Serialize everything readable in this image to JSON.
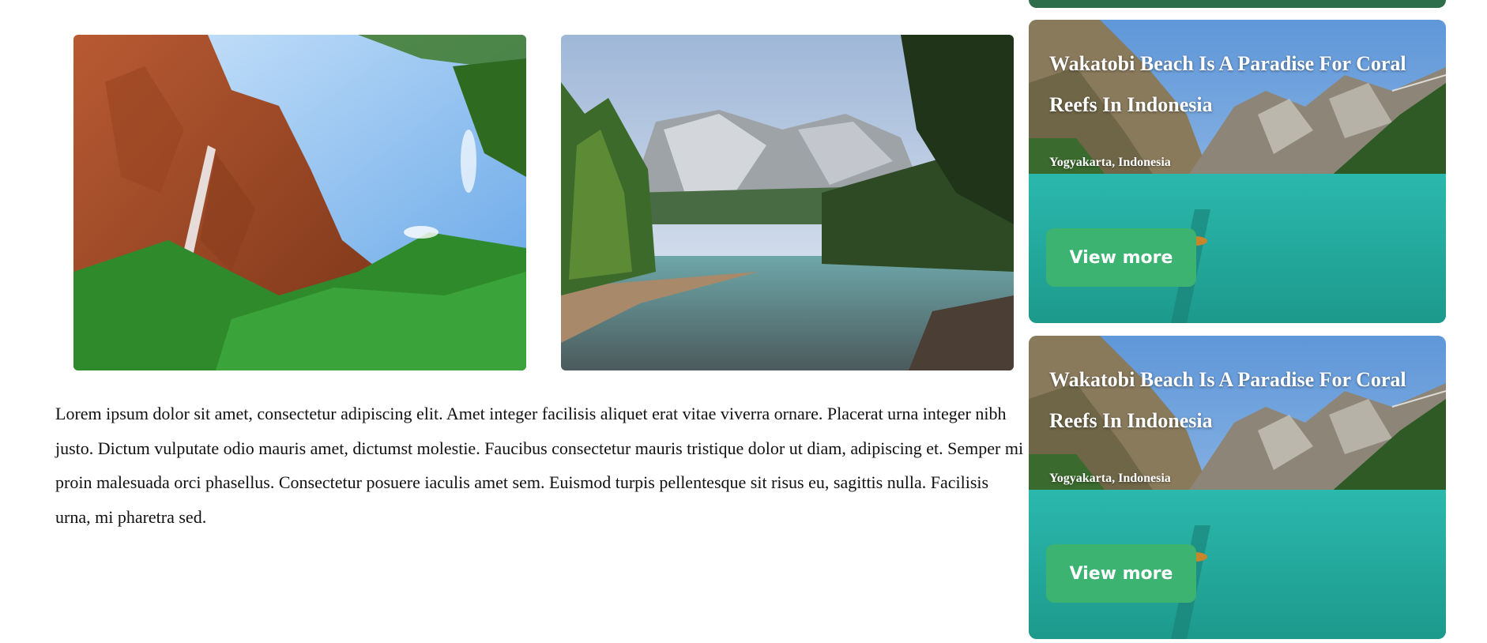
{
  "article": {
    "paragraph": "Lorem ipsum dolor sit amet, consectetur adipiscing elit. Amet integer facilisis aliquet erat vitae viverra ornare. Placerat urna integer nibh justo. Dictum vulputate odio mauris amet, dictumst molestie. Faucibus consectetur mauris tristique dolor ut diam, adipiscing et. Semper mi proin malesuada orci phasellus. Consectetur posuere iaculis amet sem. Euismod turpis pellentesque sit risus eu, sagittis nulla. Facilisis urna, mi pharetra sed."
  },
  "cards": [
    {
      "title": "Wakatobi Beach Is A Paradise For Coral Reefs In Indonesia",
      "location": "Yogyakarta, Indonesia",
      "button_label": "View more"
    },
    {
      "title": "Wakatobi Beach Is A Paradise For Coral Reefs In Indonesia",
      "location": "Yogyakarta, Indonesia",
      "button_label": "View more"
    }
  ],
  "colors": {
    "button": "#3cb371",
    "water": "#2cc2b4"
  }
}
